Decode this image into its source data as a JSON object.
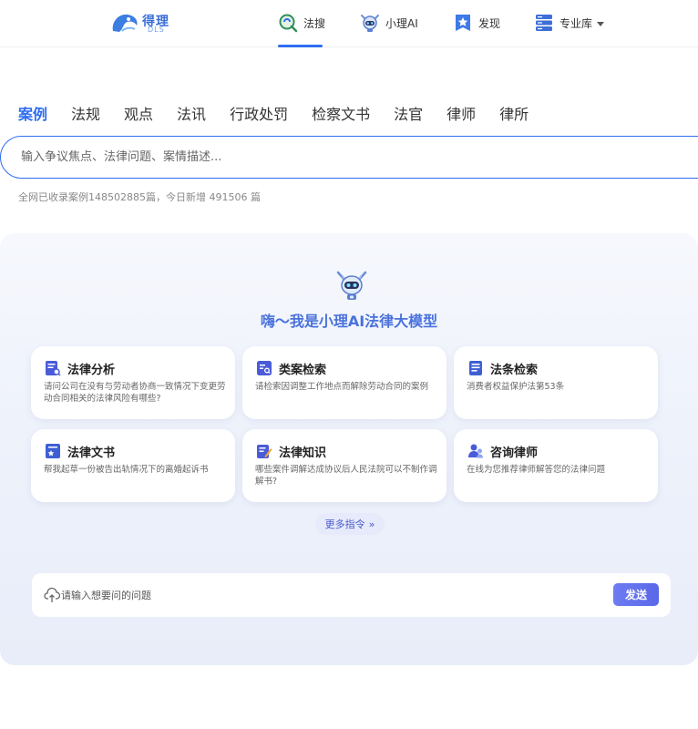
{
  "brand": {
    "name": "得理",
    "sub": "DLS"
  },
  "nav": [
    {
      "label": "法搜",
      "icon": "search-q-icon",
      "active": true
    },
    {
      "label": "小理AI",
      "icon": "robot-mascot-icon"
    },
    {
      "label": "发现",
      "icon": "star-bookmark-icon"
    },
    {
      "label": "专业库",
      "icon": "database-icon",
      "dropdown": true
    }
  ],
  "tabs": [
    "案例",
    "法规",
    "观点",
    "法讯",
    "行政处罚",
    "检察文书",
    "法官",
    "律师",
    "律所"
  ],
  "active_tab": "案例",
  "search": {
    "placeholder": "输入争议焦点、法律问题、案情描述..."
  },
  "stats_text": "全网已收录案例148502885篇，今日新增 491506 篇",
  "ai": {
    "title": "嗨～我是小理AI法律大模型",
    "cards": [
      {
        "title": "法律分析",
        "icon": "law-analysis-icon",
        "desc": "请问公司在没有与劳动者协商一致情况下变更劳动合同相关的法律风险有哪些?"
      },
      {
        "title": "类案检索",
        "icon": "case-search-icon",
        "desc": "请检索因调整工作地点而解除劳动合同的案例"
      },
      {
        "title": "法条检索",
        "icon": "statute-search-icon",
        "desc": "消费者权益保护法第53条"
      },
      {
        "title": "法律文书",
        "icon": "legal-document-icon",
        "desc": "帮我起草一份被告出轨情况下的离婚起诉书"
      },
      {
        "title": "法律知识",
        "icon": "legal-knowledge-icon",
        "desc": "哪些案件调解达成协议后人民法院可以不制作调解书?"
      },
      {
        "title": "咨询律师",
        "icon": "consult-lawyer-icon",
        "desc": "在线为您推荐律师解答您的法律问题"
      }
    ],
    "more_label": "更多指令",
    "ask_placeholder": "请输入想要问的问题",
    "send_label": "发送"
  },
  "colors": {
    "accent": "#2f6df0",
    "ai_title": "#4a72dc",
    "send": "#5a68e8"
  }
}
